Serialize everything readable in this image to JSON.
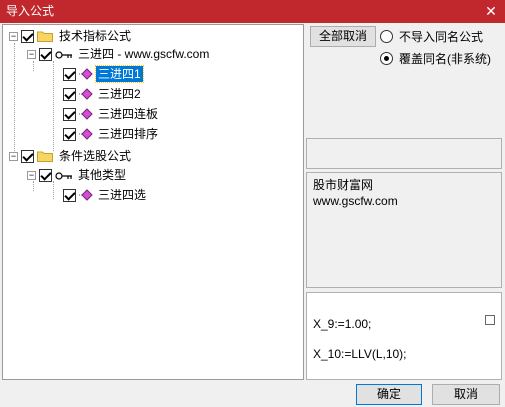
{
  "window": {
    "title": "导入公式",
    "close_glyph": "✕"
  },
  "tree": {
    "nodes": [
      {
        "label": "技术指标公式"
      },
      {
        "label": "三进四 - www.gscfw.com"
      },
      {
        "label": "三进四1"
      },
      {
        "label": "三进四2"
      },
      {
        "label": "三进四连板"
      },
      {
        "label": "三进四排序"
      },
      {
        "label": "条件选股公式"
      },
      {
        "label": "其他类型"
      },
      {
        "label": "三进四选"
      }
    ]
  },
  "controls": {
    "deselect_all": "全部取消",
    "radio_skip": "不导入同名公式",
    "radio_overwrite": "覆盖同名(非系统)"
  },
  "info": {
    "line1": "股市财富网",
    "line2": "www.gscfw.com"
  },
  "code": {
    "line1": "X_9:=1.00;",
    "line2": "X_10:=LLV(L,10);"
  },
  "footer": {
    "ok": "确定",
    "cancel": "取消"
  },
  "colors": {
    "titlebar": "#c0282e",
    "selection": "#0078d7"
  }
}
